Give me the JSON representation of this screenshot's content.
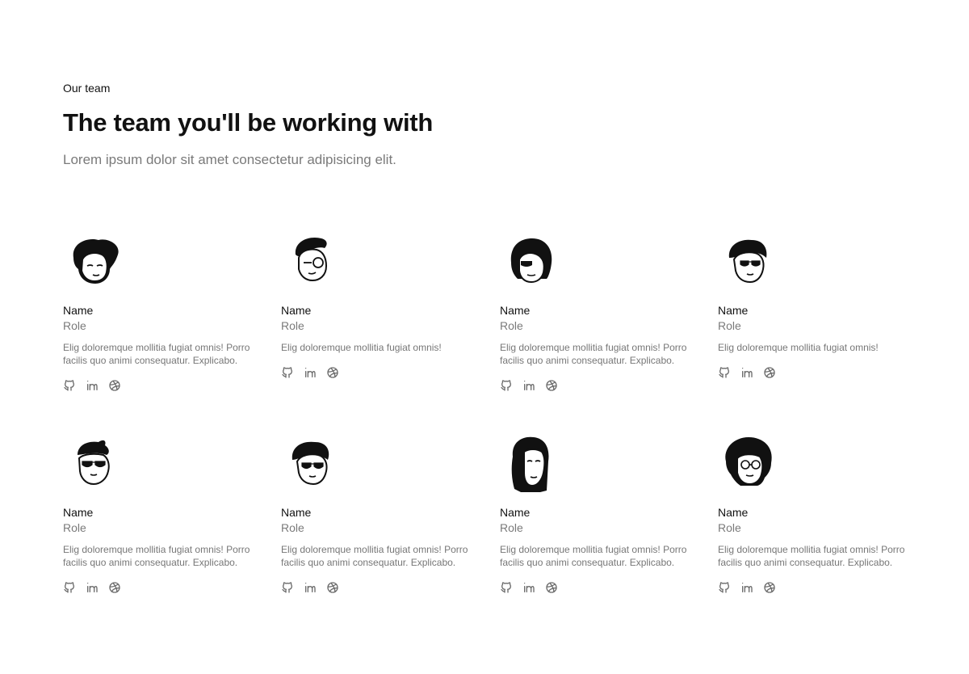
{
  "header": {
    "eyebrow": "Our team",
    "title": "The team you'll be working with",
    "subtitle": "Lorem ipsum dolor sit amet consectetur adipisicing elit."
  },
  "members": [
    {
      "name": "Name",
      "role": "Role",
      "bio": "Elig doloremque mollitia fugiat omnis! Porro facilis quo animi consequatur. Explicabo.",
      "avatar": "avatar-curly-hair-icon"
    },
    {
      "name": "Name",
      "role": "Role",
      "bio": "Elig doloremque mollitia fugiat omnis!",
      "avatar": "avatar-glasses-quiff-icon"
    },
    {
      "name": "Name",
      "role": "Role",
      "bio": "Elig doloremque mollitia fugiat omnis! Porro facilis quo animi consequatur. Explicabo.",
      "avatar": "avatar-bob-hair-icon"
    },
    {
      "name": "Name",
      "role": "Role",
      "bio": "Elig doloremque mollitia fugiat omnis!",
      "avatar": "avatar-sunglasses-icon"
    },
    {
      "name": "Name",
      "role": "Role",
      "bio": "Elig doloremque mollitia fugiat omnis! Porro facilis quo animi consequatur. Explicabo.",
      "avatar": "avatar-sunglasses-pompadour-icon"
    },
    {
      "name": "Name",
      "role": "Role",
      "bio": "Elig doloremque mollitia fugiat omnis! Porro facilis quo animi consequatur. Explicabo.",
      "avatar": "avatar-sunglasses-short-hair-icon"
    },
    {
      "name": "Name",
      "role": "Role",
      "bio": "Elig doloremque mollitia fugiat omnis! Porro facilis quo animi consequatur. Explicabo.",
      "avatar": "avatar-long-hair-icon"
    },
    {
      "name": "Name",
      "role": "Role",
      "bio": "Elig doloremque mollitia fugiat omnis! Porro facilis quo animi consequatur. Explicabo.",
      "avatar": "avatar-shaggy-hair-glasses-icon"
    }
  ],
  "socials": [
    "github-icon",
    "linkedin-icon",
    "dribbble-icon"
  ],
  "colors": {
    "text": "#111111",
    "muted": "#7a7a7a",
    "bio": "#777777",
    "icon": "#6b6b6b"
  }
}
